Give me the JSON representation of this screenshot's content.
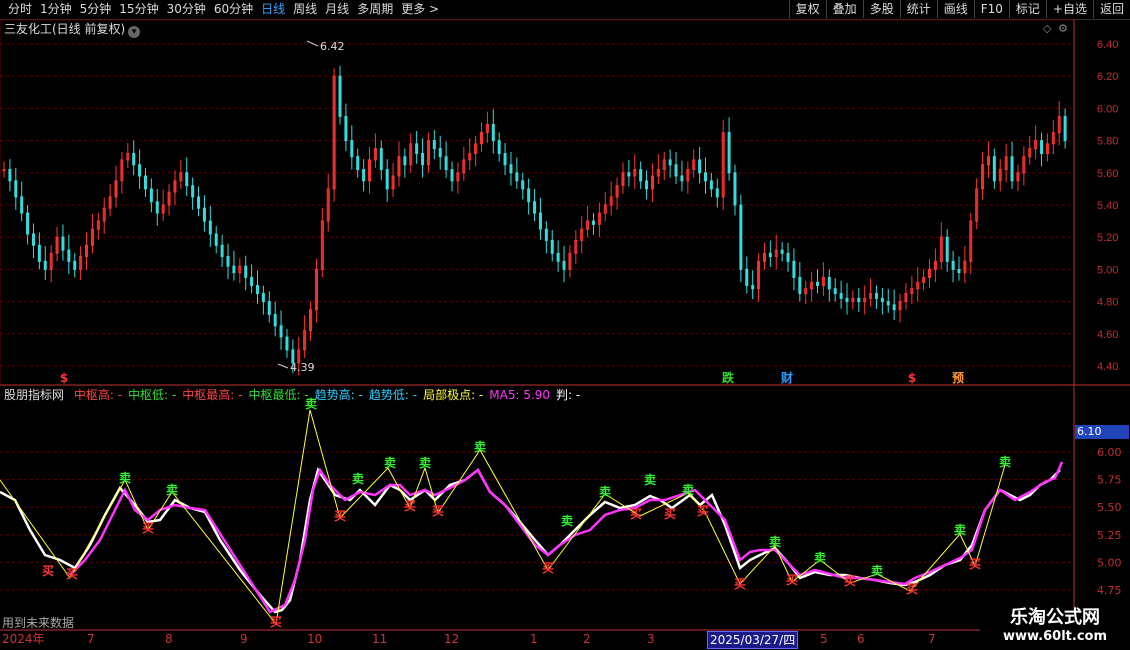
{
  "toolbar": {
    "periods": [
      "分时",
      "1分钟",
      "5分钟",
      "15分钟",
      "30分钟",
      "60分钟",
      "日线",
      "周线",
      "月线",
      "多周期",
      "更多 >"
    ],
    "active_period": "日线",
    "tools": [
      "复权",
      "叠加",
      "多股",
      "统计",
      "画线",
      "F10",
      "标记",
      "+自选",
      "返回"
    ]
  },
  "main_chart": {
    "title": "三友化工(日线 前复权)",
    "high_label": "6.42",
    "low_label": "4.39",
    "y_ticks": [
      "6.40",
      "6.20",
      "6.00",
      "5.80",
      "5.60",
      "5.40",
      "5.20",
      "5.00",
      "4.80",
      "4.60",
      "4.40"
    ],
    "markers": [
      {
        "text": "$",
        "color": "#ff3333"
      },
      {
        "text": "跌",
        "color": "#33dd33"
      },
      {
        "text": "财",
        "color": "#3399ff"
      },
      {
        "text": "$",
        "color": "#ff3333"
      },
      {
        "text": "预",
        "color": "#ff9933"
      }
    ]
  },
  "indicator": {
    "name": "股朋指标网",
    "fields": [
      {
        "label": "中枢高:",
        "value": "-",
        "color": "#ff4444"
      },
      {
        "label": "中枢低:",
        "value": "-",
        "color": "#33dd33"
      },
      {
        "label": "中枢最高:",
        "value": "-",
        "color": "#ff4444"
      },
      {
        "label": "中枢最低:",
        "value": "-",
        "color": "#33dd33"
      },
      {
        "label": "趋势高:",
        "value": "-",
        "color": "#33ccff"
      },
      {
        "label": "趋势低:",
        "value": "-",
        "color": "#33ccff"
      },
      {
        "label": "局部极点:",
        "value": "-",
        "color": "#ffff33"
      },
      {
        "label": "MA5:",
        "value": "5.90",
        "color": "#ff33ff"
      },
      {
        "label": "判:",
        "value": "-",
        "color": "#ffffff"
      }
    ],
    "y_ticks": [
      "6.00",
      "5.75",
      "5.50",
      "5.25",
      "5.00",
      "4.75"
    ],
    "flag_value": "6.10",
    "sell_label": "卖",
    "buy_label": "买"
  },
  "bottom_note": "用到未来数据",
  "date_axis": {
    "labels": [
      "2024年",
      "7",
      "8",
      "9",
      "10",
      "11",
      "12",
      "1",
      "2",
      "3",
      "2025/03/27/四",
      "5",
      "6",
      "7"
    ]
  },
  "watermark": {
    "line1": "乐淘公式网",
    "line2": "www.60lt.com"
  },
  "colors": {
    "up": "#ff3333",
    "down": "#33dddd",
    "grid": "#5a0000",
    "axis": "#c03030",
    "ma5": "#ff33ff",
    "line": "#ffffff",
    "zigzag": "#ffff33"
  }
}
